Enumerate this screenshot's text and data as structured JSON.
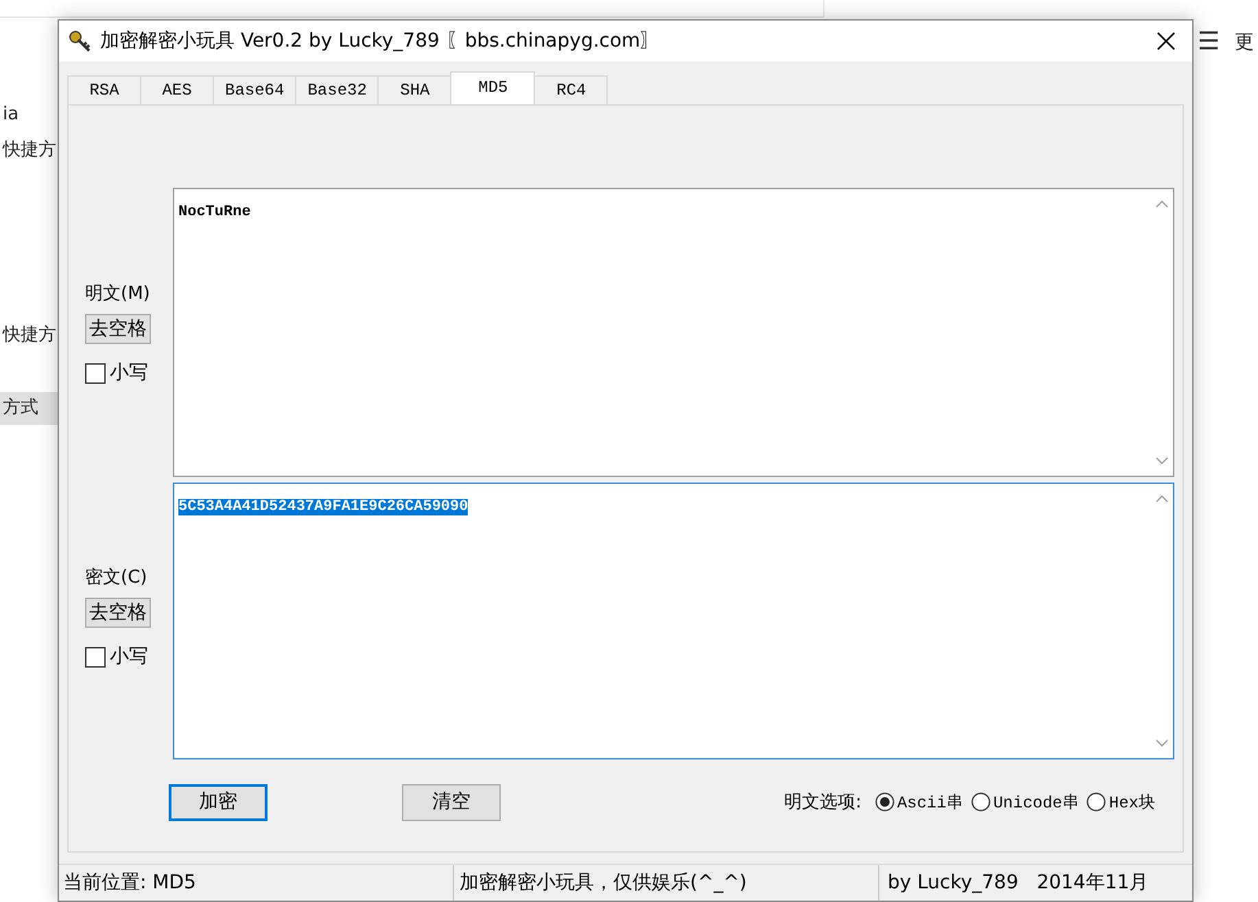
{
  "background": {
    "left_items": [
      {
        "label": "ia",
        "selected": false
      },
      {
        "label": "快捷方",
        "selected": false
      },
      {
        "label": "快捷方",
        "selected": false
      },
      {
        "label": "方式",
        "selected": true
      }
    ],
    "menu_glyph": "☰",
    "right_label": "更"
  },
  "window": {
    "title": "加密解密小玩具 Ver0.2 by Lucky_789 〖bbs.chinapyg.com〗"
  },
  "tabs": [
    {
      "label": "RSA",
      "selected": false
    },
    {
      "label": "AES",
      "selected": false
    },
    {
      "label": "Base64",
      "selected": false
    },
    {
      "label": "Base32",
      "selected": false
    },
    {
      "label": "SHA",
      "selected": false
    },
    {
      "label": "MD5",
      "selected": true
    },
    {
      "label": "RC4",
      "selected": false
    }
  ],
  "sections": [
    {
      "label": "明文(M)",
      "button": "去空格",
      "checkbox": {
        "label": "小写",
        "checked": false
      },
      "text": "NocTuRne",
      "text_selected": false,
      "focused": false
    },
    {
      "label": "密文(C)",
      "button": "去空格",
      "checkbox": {
        "label": "小写",
        "checked": false
      },
      "text": "5C53A4A41D52437A9FA1E9C26CA59090",
      "text_selected": true,
      "focused": true
    }
  ],
  "buttons": [
    {
      "label": "加密",
      "default": true
    },
    {
      "label": "清空",
      "default": false
    }
  ],
  "options": {
    "label": "明文选项:",
    "radios": [
      {
        "label": "Ascii串",
        "selected": true
      },
      {
        "label": "Unicode串",
        "selected": false
      },
      {
        "label": "Hex块",
        "selected": false
      }
    ]
  },
  "status_bar": [
    "当前位置: MD5",
    "加密解密小玩具，仅供娱乐(^_^)",
    "by Lucky_789   2014年11月"
  ]
}
